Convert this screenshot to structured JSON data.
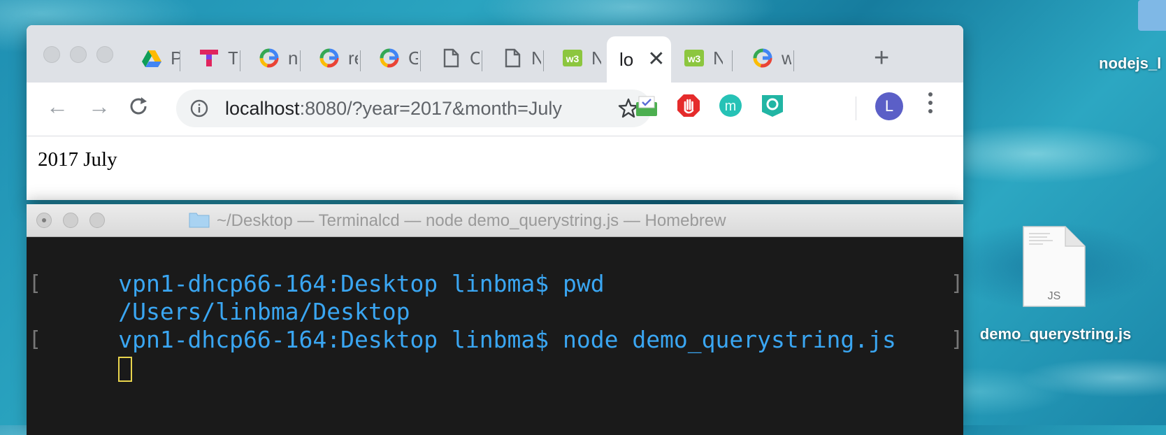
{
  "browser": {
    "tabs": [
      {
        "title": "P",
        "icon": "google-drive-icon"
      },
      {
        "title": "T",
        "icon": "t-logo-icon"
      },
      {
        "title": "n",
        "icon": "google-icon"
      },
      {
        "title": "re",
        "icon": "google-icon"
      },
      {
        "title": "G",
        "icon": "google-icon"
      },
      {
        "title": "C",
        "icon": "document-icon"
      },
      {
        "title": "N",
        "icon": "document-icon"
      },
      {
        "title": "N",
        "icon": "w3schools-icon"
      },
      {
        "title": "lo",
        "icon": "none",
        "active": true
      },
      {
        "title": "N",
        "icon": "w3schools-icon"
      },
      {
        "title": "w",
        "icon": "google-icon"
      }
    ],
    "new_tab_label": "+",
    "close_tab_label": "✕",
    "url_host": "localhost",
    "url_rest": ":8080/?year=2017&month=July",
    "avatar_letter": "L",
    "extensions": [
      "mail-check-icon",
      "adblock-icon",
      "m-extension-icon",
      "ring-extension-icon"
    ],
    "page_text": "2017 July"
  },
  "terminal": {
    "title": "~/Desktop — Terminalcd  — node demo_querystring.js — Homebrew",
    "lines": [
      "vpn1-dhcp66-164:Desktop linbma$ pwd",
      "/Users/linbma/Desktop",
      "vpn1-dhcp66-164:Desktop linbma$ node demo_querystring.js"
    ],
    "text_color": "#3aa6f2",
    "cursor_color": "#e8d44d"
  },
  "desktop": {
    "top_label": "nodejs_l",
    "file_badge": "JS",
    "file_name": "demo_querystring.js"
  }
}
